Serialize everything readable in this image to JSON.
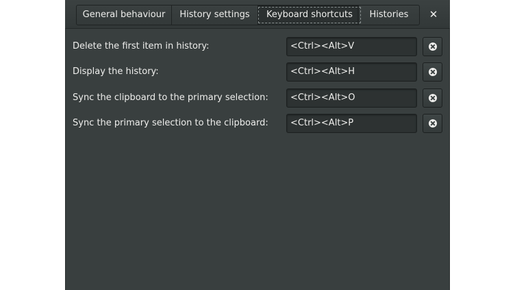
{
  "tabs": [
    {
      "label": "General behaviour",
      "active": false
    },
    {
      "label": "History settings",
      "active": false
    },
    {
      "label": "Keyboard shortcuts",
      "active": true
    },
    {
      "label": "Histories",
      "active": false
    }
  ],
  "window": {
    "close_glyph": "✕"
  },
  "shortcuts": [
    {
      "label": "Delete the first item in history:",
      "value": "<Ctrl><Alt>V",
      "clear_icon": "clear-icon"
    },
    {
      "label": "Display the history:",
      "value": "<Ctrl><Alt>H",
      "clear_icon": "clear-icon"
    },
    {
      "label": "Sync the clipboard to the primary selection:",
      "value": "<Ctrl><Alt>O",
      "clear_icon": "clear-icon"
    },
    {
      "label": "Sync the primary selection to the clipboard:",
      "value": "<Ctrl><Alt>P",
      "clear_icon": "clear-icon"
    }
  ],
  "colors": {
    "background": "#393f3f",
    "text": "#eeeeec",
    "entry": "#2d3232"
  }
}
